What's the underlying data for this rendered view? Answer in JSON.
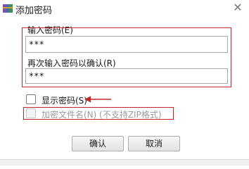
{
  "window": {
    "title": "添加密码",
    "icon": "winrar-app-icon",
    "close_glyph": "✕"
  },
  "password": {
    "label": "输入密码(E)",
    "value": "***"
  },
  "confirm": {
    "label": "再次输入密码以确认(R)",
    "value": "***"
  },
  "show_password": {
    "label": "显示密码(S)",
    "checked": false
  },
  "encrypt_filenames": {
    "label": "加密文件名(N) (不支持ZIP格式)",
    "checked": false,
    "enabled": false
  },
  "buttons": {
    "ok": "确认",
    "cancel": "取消"
  },
  "colors": {
    "annotation": "#c6252b"
  }
}
